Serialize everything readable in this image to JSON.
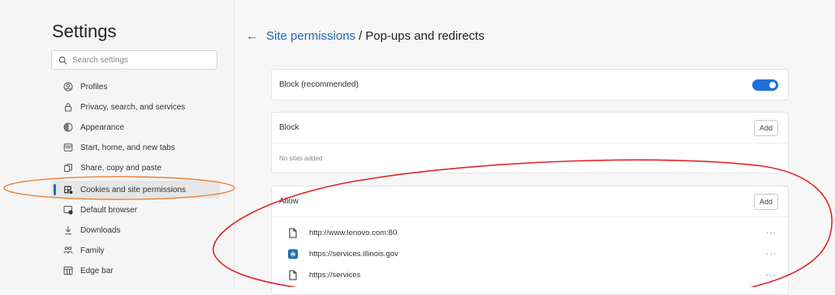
{
  "sidebar": {
    "title": "Settings",
    "search": {
      "placeholder": "Search settings",
      "value": ""
    },
    "items": [
      {
        "label": "Profiles",
        "icon": "profile-icon",
        "active": false
      },
      {
        "label": "Privacy, search, and services",
        "icon": "lock-icon",
        "active": false
      },
      {
        "label": "Appearance",
        "icon": "appearance-icon",
        "active": false
      },
      {
        "label": "Start, home, and new tabs",
        "icon": "home-tabs-icon",
        "active": false
      },
      {
        "label": "Share, copy and paste",
        "icon": "share-icon",
        "active": false
      },
      {
        "label": "Cookies and site permissions",
        "icon": "cookies-icon",
        "active": true
      },
      {
        "label": "Default browser",
        "icon": "default-browser-icon",
        "active": false
      },
      {
        "label": "Downloads",
        "icon": "download-icon",
        "active": false
      },
      {
        "label": "Family",
        "icon": "family-icon",
        "active": false
      },
      {
        "label": "Edge bar",
        "icon": "edge-bar-icon",
        "active": false
      }
    ]
  },
  "header": {
    "back_icon": "arrow-left-icon",
    "breadcrumb_link": "Site permissions",
    "separator": "/",
    "current": "Pop-ups and redirects"
  },
  "block_recommended": {
    "label": "Block (recommended)",
    "enabled": true
  },
  "block_section": {
    "title": "Block",
    "add_label": "Add",
    "empty_text": "No sites added"
  },
  "allow_section": {
    "title": "Allow",
    "add_label": "Add",
    "sites": [
      {
        "url": "http://www.lenovo.com:80",
        "icon": "page-icon",
        "more": "···"
      },
      {
        "url": "https://services.illinois.gov",
        "icon": "site-favicon-icon",
        "more": "···"
      },
      {
        "url": "https://services",
        "icon": "page-icon",
        "more": "···"
      }
    ]
  },
  "colors": {
    "accent": "#1f6fd6",
    "annotation_orange": "#e8833a",
    "annotation_red": "#e0262c"
  }
}
